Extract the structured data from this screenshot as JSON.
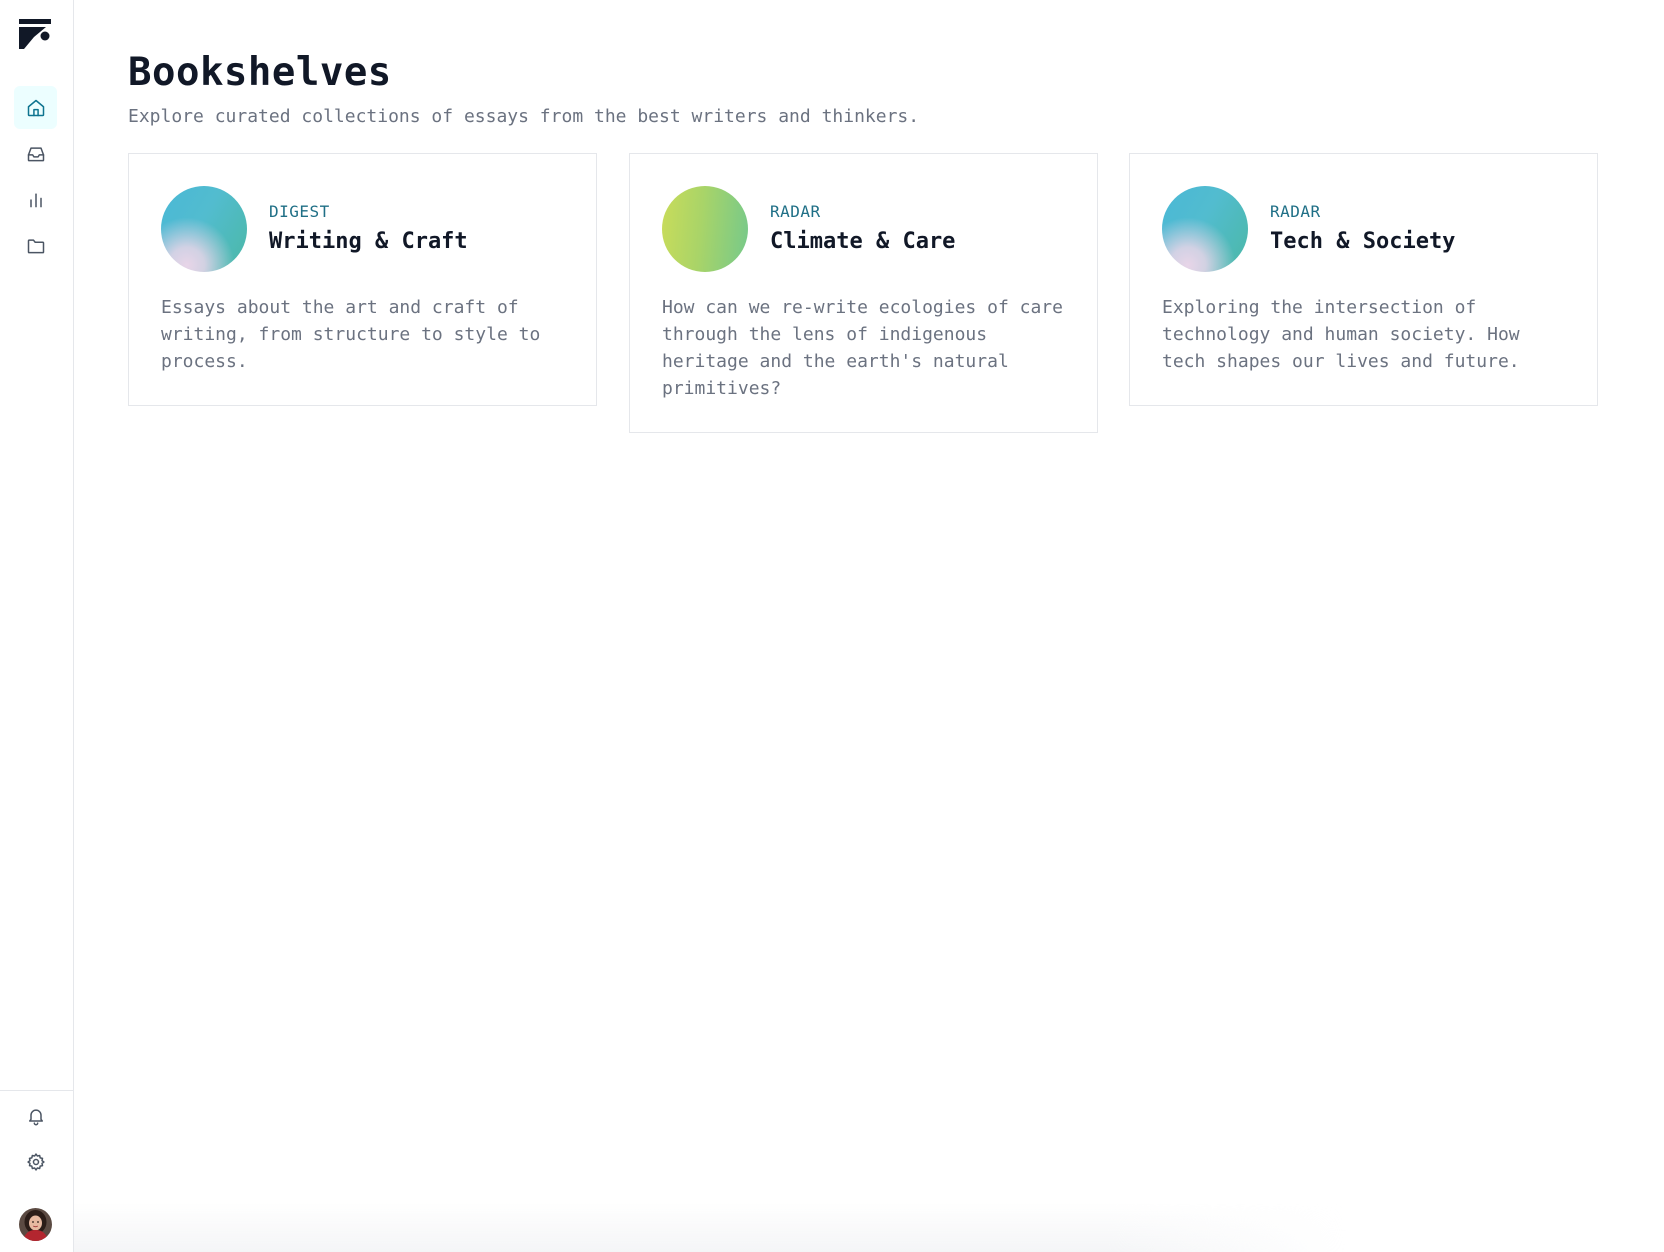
{
  "page": {
    "title": "Bookshelves",
    "subtitle": "Explore curated collections of essays from the best writers and thinkers."
  },
  "sidebar": {
    "logo": "app-logo",
    "nav": [
      {
        "id": "home",
        "icon": "home-icon",
        "active": true
      },
      {
        "id": "inbox",
        "icon": "inbox-icon",
        "active": false
      },
      {
        "id": "analytics",
        "icon": "bar-chart-icon",
        "active": false
      },
      {
        "id": "folders",
        "icon": "folder-icon",
        "active": false
      }
    ],
    "bottom": [
      {
        "id": "notifications",
        "icon": "bell-icon"
      },
      {
        "id": "settings",
        "icon": "gear-icon"
      },
      {
        "id": "profile",
        "icon": "avatar"
      }
    ]
  },
  "cards": [
    {
      "tag": "DIGEST",
      "title": "Writing & Craft",
      "description": "Essays about the art and craft of writing, from structure to style to process.",
      "orb": "teal-pink-gradient"
    },
    {
      "tag": "RADAR",
      "title": "Climate & Care",
      "description": "How can we re-write ecologies of care through the lens of indigenous heritage and the earth's natural primitives?",
      "orb": "lime-green-gradient"
    },
    {
      "tag": "RADAR",
      "title": "Tech & Society",
      "description": "Exploring the intersection of technology and human society. How tech shapes our lives and future.",
      "orb": "teal-pink-gradient"
    }
  ],
  "colors": {
    "accent": "#0e7490",
    "tag": "#1f6f86",
    "title": "#111827",
    "muted": "#6b7280",
    "border": "#e5e7eb",
    "active_nav_bg": "#ecfeff"
  }
}
